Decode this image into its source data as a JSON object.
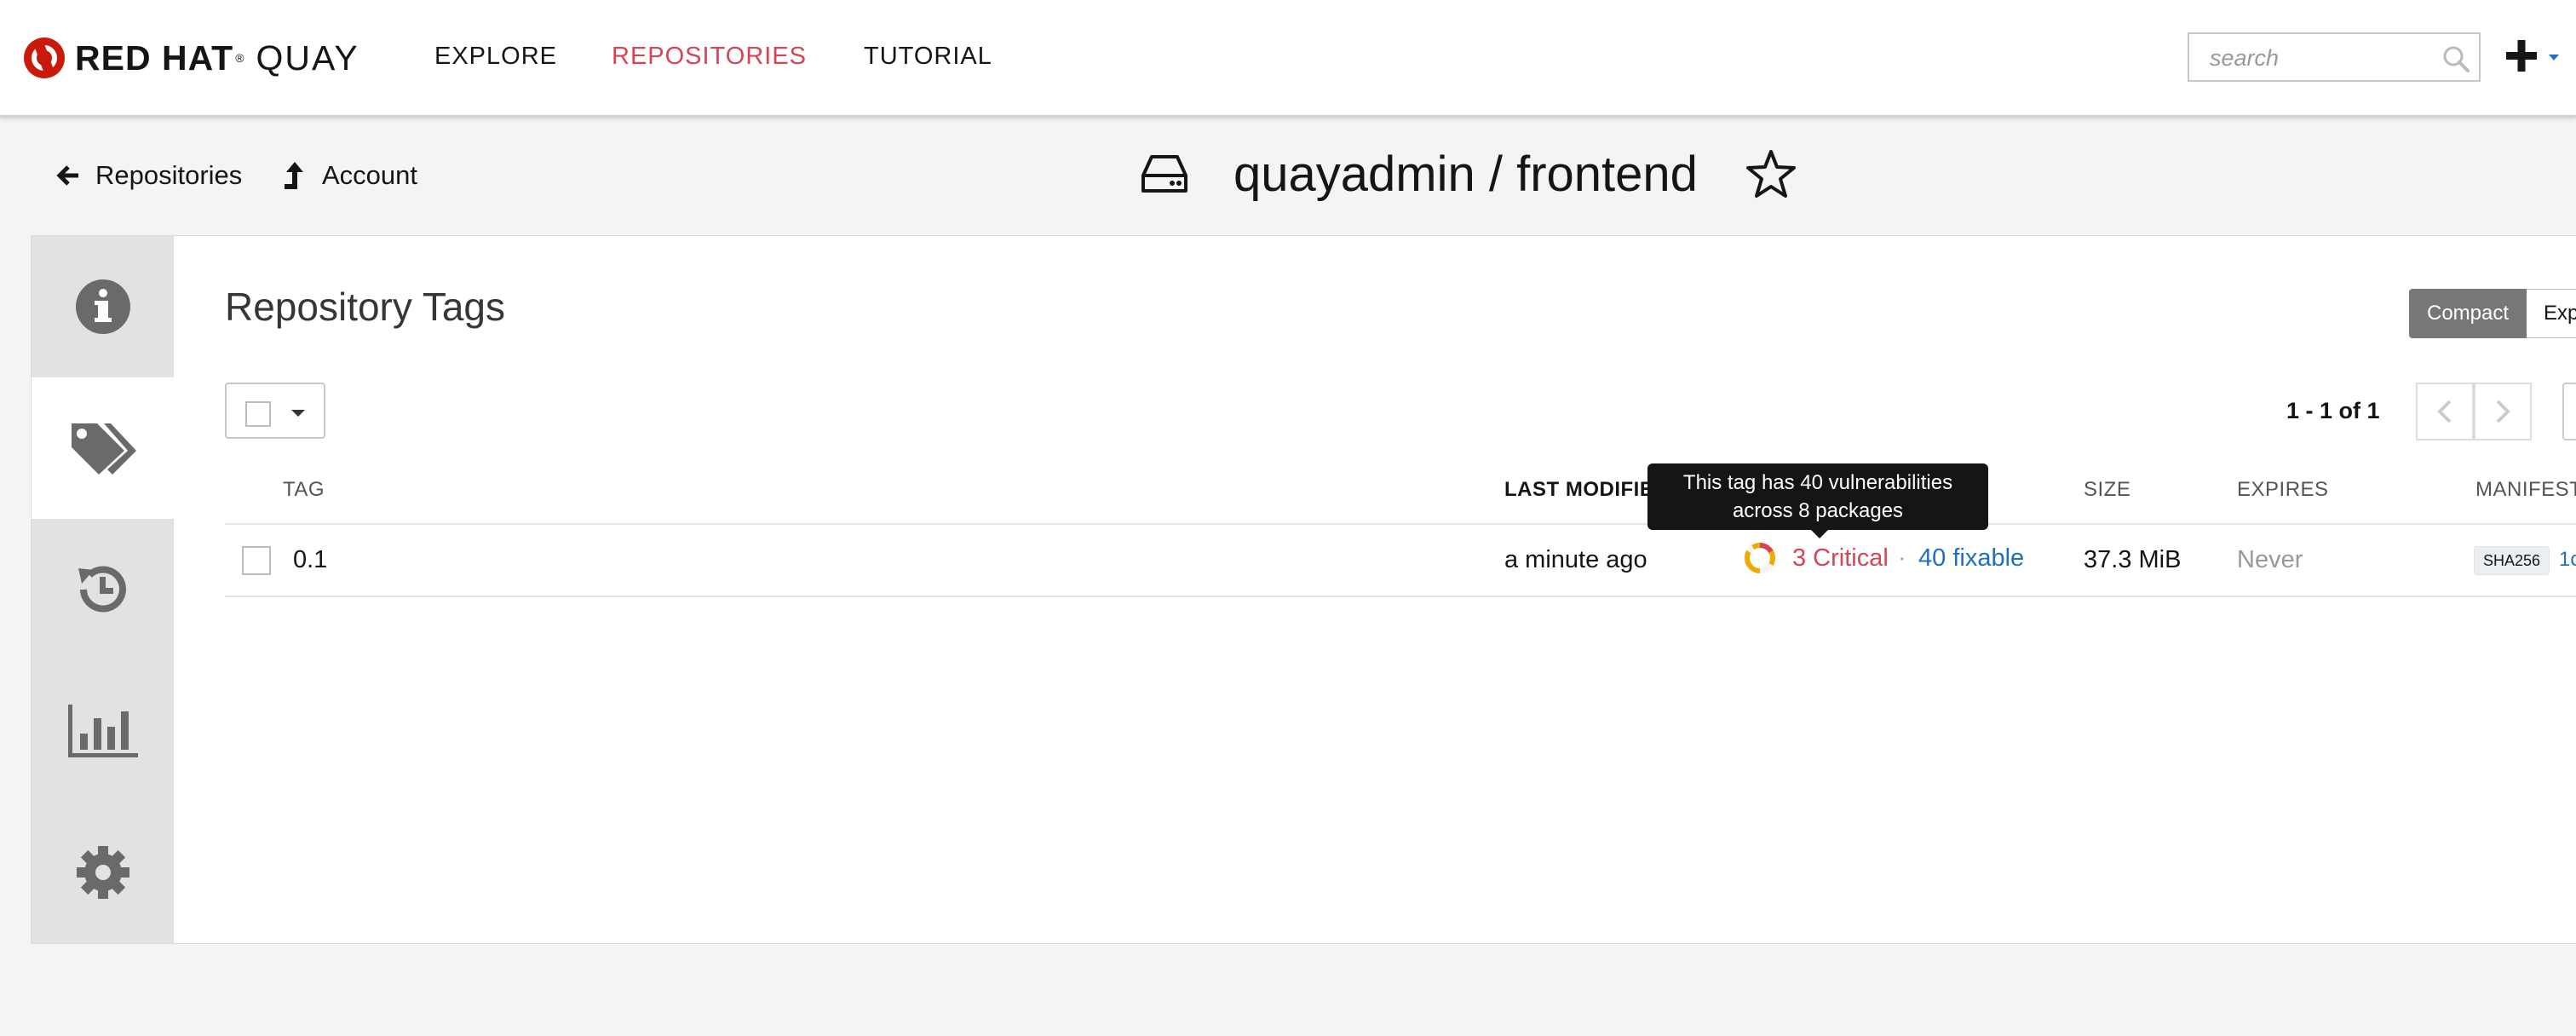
{
  "brand": {
    "name": "RED HAT",
    "product": "QUAY"
  },
  "nav": {
    "explore": "EXPLORE",
    "repositories": "REPOSITORIES",
    "tutorial": "TUTORIAL",
    "active_color": "#d64456"
  },
  "search": {
    "placeholder": "search"
  },
  "breadcrumbs": {
    "repositories": "Repositories",
    "account": "Account"
  },
  "repo": {
    "title": "quayadmin / frontend"
  },
  "side_tabs": [
    "info-icon",
    "tags-icon",
    "history-icon",
    "usage-chart-icon",
    "settings-icon"
  ],
  "tags_panel": {
    "title": "Repository Tags",
    "view_toggle": {
      "compact": "Compact",
      "expanded": "Exp"
    },
    "paging": "1 - 1 of 1",
    "columns": {
      "tag": "TAG",
      "last_modified": "LAST MODIFIED",
      "size": "SIZE",
      "expires": "EXPIRES",
      "manifest": "MANIFEST"
    },
    "rows": [
      {
        "tag": "0.1",
        "last_modified": "a minute ago",
        "vuln_critical": "3 Critical",
        "vuln_sep": "·",
        "vuln_fixable": "40 fixable",
        "size": "37.3 MiB",
        "expires": "Never",
        "manifest_badge": "SHA256",
        "manifest_digest": "1c"
      }
    ],
    "tooltip": {
      "line1": "This tag has 40 vulnerabilities",
      "line2": "across 8 packages"
    }
  },
  "colors": {
    "critical": "#d64456",
    "link": "#1f6fbf",
    "side_bg": "#e2e2e2",
    "page_bg": "#f4f4f4"
  }
}
